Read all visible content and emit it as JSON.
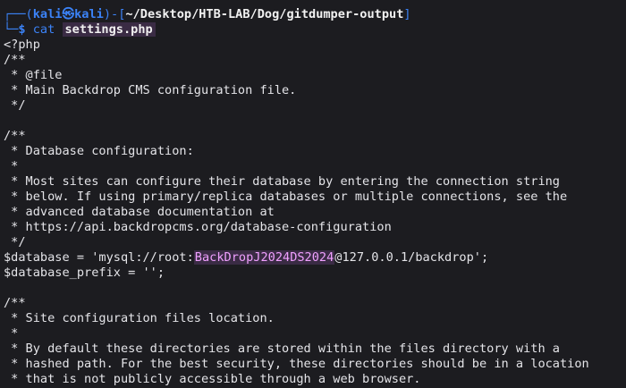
{
  "prompt": {
    "open_bracket": "┌──(",
    "user": "kali",
    "at": "㉿",
    "host": "kali",
    "mid": ")-[",
    "path": "~/Desktop/HTB-LAB/Dog/gitdumper-output",
    "close_bracket": "]",
    "second_prefix": "└─",
    "dollar": "$",
    "command": "cat",
    "argument": "settings.php"
  },
  "file_lines": [
    "<?php",
    "/**",
    " * @file",
    " * Main Backdrop CMS configuration file.",
    " */",
    "",
    "/**",
    " * Database configuration:",
    " *",
    " * Most sites can configure their database by entering the connection string",
    " * below. If using primary/replica databases or multiple connections, see the",
    " * advanced database documentation at",
    " * https://api.backdropcms.org/database-configuration",
    " */"
  ],
  "database_line": {
    "prefix": "$database = 'mysql://root:",
    "password": "BackDropJ2024DS2024",
    "suffix": "@127.0.0.1/backdrop';"
  },
  "file_lines_after": [
    "$database_prefix = '';",
    "",
    "/**",
    " * Site configuration files location.",
    " *",
    " * By default these directories are stored within the files directory with a",
    " * hashed path. For the best security, these directories should be in a location",
    " * that is not publicly accessible through a web browser."
  ],
  "colors": {
    "background": "#1c1c20",
    "accent": "#3b82f6",
    "highlight": "#3a2b44"
  }
}
